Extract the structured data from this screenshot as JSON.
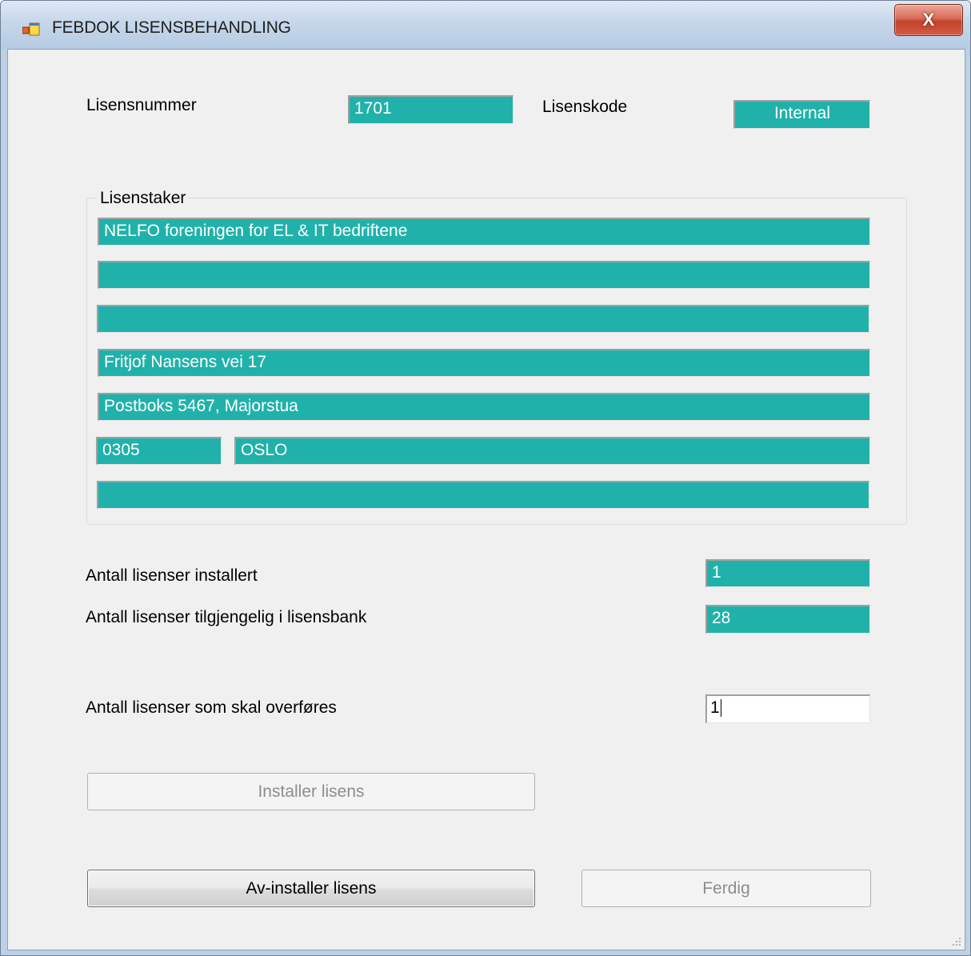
{
  "window": {
    "title": "FEBDOK LISENSBEHANDLING",
    "close_symbol": "X",
    "app_icon": "app-window-icon"
  },
  "license": {
    "number_label": "Lisensnummer",
    "number_value": "1701",
    "code_label": "Lisenskode",
    "code_value": "Internal"
  },
  "licensee": {
    "legend": "Lisenstaker",
    "line1": "NELFO foreningen for EL & IT bedriftene",
    "line2": "",
    "line3": "",
    "address1": "Fritjof Nansens vei 17",
    "address2": "Postboks 5467, Majorstua",
    "postal_code": "0305",
    "city": "OSLO",
    "line7": ""
  },
  "counts": {
    "installed_label": "Antall lisenser installert",
    "installed_value": "1",
    "available_label": "Antall lisenser tilgjengelig i lisensbank",
    "available_value": "28",
    "transfer_label": "Antall lisenser som skal overføres",
    "transfer_value": "1"
  },
  "buttons": {
    "install": "Installer lisens",
    "uninstall": "Av-installer lisens",
    "done": "Ferdig"
  },
  "colors": {
    "field_bg": "#20b2aa",
    "form_bg": "#f0f0f0"
  }
}
